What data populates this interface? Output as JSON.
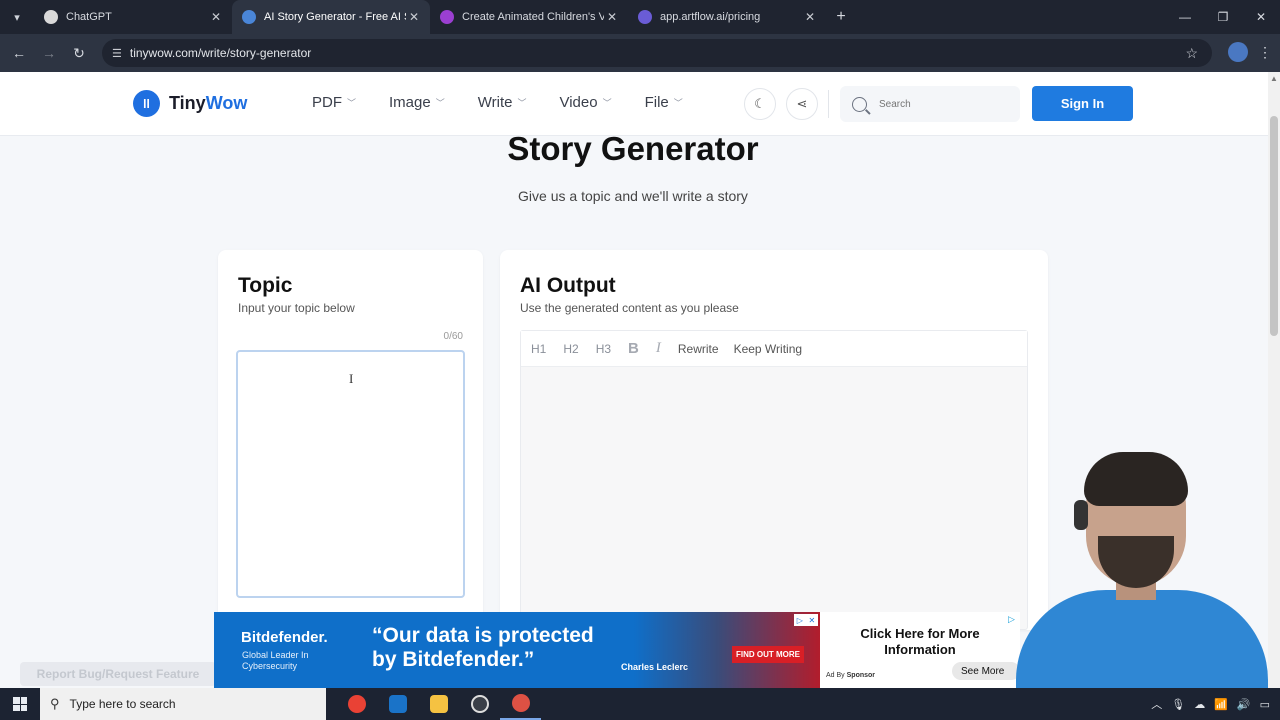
{
  "browser": {
    "tabs": [
      {
        "title": "ChatGPT",
        "favicon_color": "#d9d9d9",
        "active": false
      },
      {
        "title": "AI Story Generator - Free AI Sto",
        "favicon_color": "#4a86d8",
        "active": true
      },
      {
        "title": "Create Animated Children's Vid",
        "favicon_color": "#9b3fd1",
        "active": false
      },
      {
        "title": "app.artflow.ai/pricing",
        "favicon_color": "#6a5cd6",
        "active": false
      }
    ],
    "url": "tinywow.com/write/story-generator"
  },
  "site": {
    "logo_main": "Tiny",
    "logo_accent": "Wow",
    "nav": [
      "PDF",
      "Image",
      "Write",
      "Video",
      "File"
    ],
    "search_placeholder": "Search",
    "signin_label": "Sign In",
    "brand_color": "#1f7be0"
  },
  "page": {
    "title": "Story Generator",
    "subtitle": "Give us a topic and we'll write a story"
  },
  "topic": {
    "title": "Topic",
    "subtitle": "Input your topic below",
    "counter": "0/60",
    "value": ""
  },
  "output": {
    "title": "AI Output",
    "subtitle": "Use the generated content as you please",
    "toolbar": {
      "h1": "H1",
      "h2": "H2",
      "h3": "H3",
      "bold": "B",
      "italic": "I",
      "rewrite": "Rewrite",
      "keep_writing": "Keep Writing"
    }
  },
  "report_bug": "Report Bug/Request Feature",
  "ad": {
    "brand": "Bitdefender.",
    "tagline": "Global Leader In Cybersecurity",
    "quote_line1": "“Our data is protected",
    "quote_line2": "by Bitdefender.”",
    "person": "Charles Leclerc",
    "cta": "FIND OUT MORE",
    "right_title": "Click Here for More Information",
    "by_label": "Ad By",
    "by_sponsor": "Sponsor",
    "see_more": "See More"
  },
  "taskbar": {
    "search_placeholder": "Type here to search",
    "apps": [
      {
        "name": "chrome",
        "color": "#e94235"
      },
      {
        "name": "outlook",
        "color": "#1a73c8"
      },
      {
        "name": "explorer",
        "color": "#f5c242"
      },
      {
        "name": "obs",
        "color": "#3a3f48"
      },
      {
        "name": "chrome-profile",
        "color": "#dd5144"
      }
    ]
  }
}
